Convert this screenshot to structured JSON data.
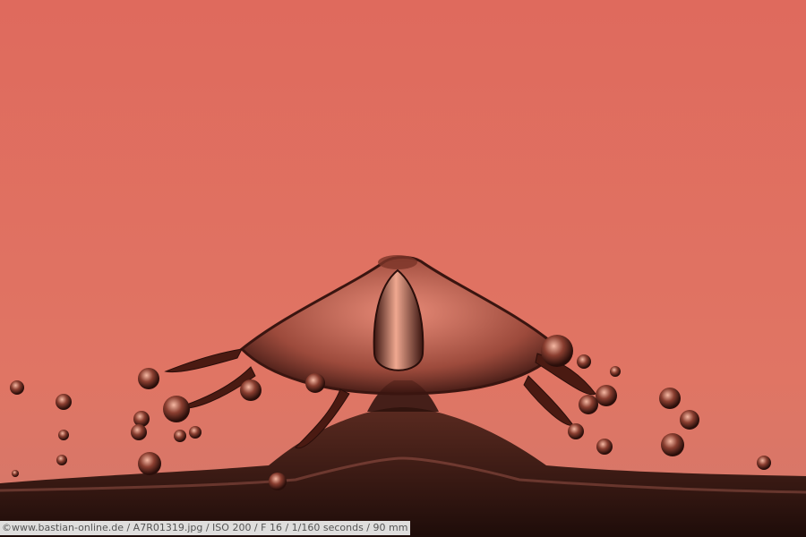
{
  "image": {
    "kind": "photograph",
    "subject": "water-drop-splash",
    "colors": {
      "backdrop_top": "#e06a5e",
      "backdrop_bottom": "#d8796a",
      "water_dark": "#3a1a14",
      "water_mid": "#7a3a2c",
      "highlight": "#f3b39f"
    }
  },
  "caption": {
    "text": "©www.bastian-online.de / A7R01319.jpg / ISO 200 / F 16 / 1/160 seconds  / 90 mm"
  }
}
